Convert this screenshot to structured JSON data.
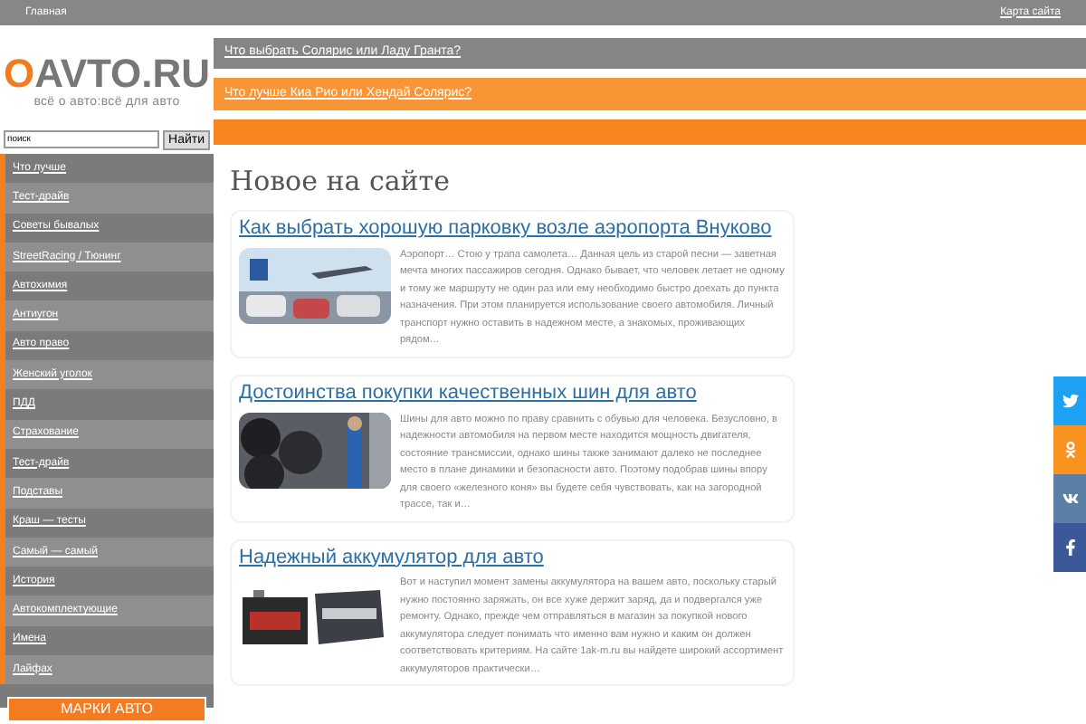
{
  "top_bar": {
    "home_link": "Главная",
    "sitemap_link": "Карта сайта"
  },
  "logo": {
    "name": "OAVTO.RU",
    "tagline": "всё о авто:всё для авто"
  },
  "header_links": [
    {
      "label": "Что выбрать Солярис или Ладу Гранта?",
      "kind": "gray"
    },
    {
      "label": "Что лучше Киа Рио или Хендай Солярис?",
      "kind": "orange"
    },
    {
      "kind": "orange"
    }
  ],
  "search": {
    "value": "поиск",
    "button": "Найти"
  },
  "sidebar": {
    "items": [
      "Что лучше",
      "Тест-драйв",
      "Советы бывалых",
      "StreetRacing / Тюнинг",
      "Автохимия",
      "Антиугон",
      "Авто право",
      "Женский уголок",
      "ПДД",
      "Страхование",
      "Тест-драйв",
      "Подставы",
      "Краш — тесты",
      "Самый — самый",
      "История",
      "Автокомплектующие",
      "Имена",
      "Лайфах"
    ],
    "button": "МАРКИ АВТО"
  },
  "main": {
    "heading": "Новое на сайте",
    "articles": [
      {
        "title": "Как выбрать хорошую парковку возле аэропорта Внуково",
        "text": "Аэропорт… Стою у трапа самолета… Данная цель из старой песни — заветная мечта многих пассажиров сегодня. Однако бывает, что человек летает не одному и тому же маршруту не один раз или ему необходимо быстро доехать до пункта назначения. При этом планируется использование своего автомобиля. Личный транспорт нужно оставить в надежном месте, а знакомых, проживающих рядом…",
        "kind": "picture"
      },
      {
        "title": "Достоинства покупки качественных шин для авто",
        "text": "Шины для авто можно по праву сравнить с обувью для человека. Безусловно, в надежности автомобиля на первом месте находится мощность двигателя, состояние трансмиссии, однако шины также занимают далеко не последнее место в плане динамики и безопасности авто. Поэтому подобрав шины впору для своего «железного коня» вы будете себя чувствовать, как на загородной трассе, так и…",
        "kind": "picture"
      },
      {
        "title": "Надежный аккумулятор для авто",
        "text": "Вот и наступил момент замены аккумулятора на вашем авто, поскольку старый нужно постоянно заряжать, он все хуже держит заряд, да и подвергался уже ремонту. Однако, прежде чем отправляться в магазин за покупкой нового аккумулятора следует понимать что именно вам нужно и каким он должен соответствовать критериям. На сайте 1ak-m.ru вы найдете широкий ассортимент аккумуляторов практически…",
        "kind": "picture"
      }
    ]
  },
  "social": [
    {
      "kind": "twitter",
      "color": "#1da1f2"
    },
    {
      "kind": "ok",
      "color": "#f7931e"
    },
    {
      "kind": "vk",
      "color": "#5b7fa6"
    },
    {
      "kind": "facebook",
      "color": "#3b5998"
    }
  ]
}
